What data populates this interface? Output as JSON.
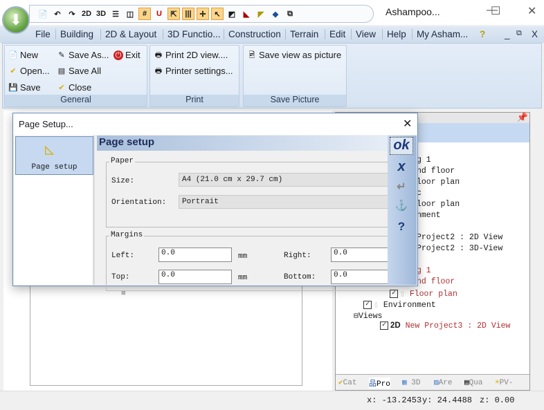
{
  "window": {
    "title": "Ashampoo...",
    "minimize": "—",
    "maximize": "☐",
    "close": "✕"
  },
  "qat": [
    "📄",
    "↶",
    "↷",
    "2D",
    "3D",
    "☰",
    "◫",
    "#",
    "U",
    "⇱",
    "|||",
    "✛",
    "↖",
    "◩",
    "◣",
    "◤",
    "◆",
    "⧉"
  ],
  "menu": {
    "tabs": [
      "File",
      "Building",
      "2D & Layout",
      "3D Functio...",
      "Construction",
      "Terrain",
      "Edit",
      "View",
      "Help",
      "My Asham..."
    ],
    "help_icon": "?",
    "win_min": "_",
    "win_restore": "⧉",
    "win_close": "X"
  },
  "ribbon": {
    "general": {
      "label": "General",
      "new": "New",
      "open": "Open...",
      "save": "Save",
      "save_as": "Save As...",
      "save_all": "Save All",
      "close": "Close",
      "exit": "Exit"
    },
    "print": {
      "label": "Print",
      "print_2d": "Print 2D view....",
      "printer_settings": "Printer settings..."
    },
    "save_picture": {
      "label": "Save Picture",
      "save_view": "Save view as picture"
    }
  },
  "dialog": {
    "title": "Page Setup...",
    "close": "✕",
    "nav_item": "Page setup",
    "header": "Page setup",
    "paper": {
      "legend": "Paper",
      "size_label": "Size:",
      "size_value": "A4   (21.0 cm x 29.7 cm)",
      "orientation_label": "Orientation:",
      "orientation_value": "Portrait"
    },
    "margins": {
      "legend": "Margins",
      "left_label": "Left:",
      "left_value": "0.0",
      "right_label": "Right:",
      "right_value": "0.0",
      "top_label": "Top:",
      "top_value": "0.0",
      "bottom_label": "Bottom:",
      "bottom_value": "0.0",
      "unit": "mm"
    },
    "buttons": {
      "ok": "ok",
      "cancel": "x",
      "apply": "↵",
      "anchor": "⚓",
      "help": "?"
    }
  },
  "tree": [
    {
      "text": "g 1",
      "red": false
    },
    {
      "text": "nd floor",
      "red": false
    },
    {
      "text": "loor plan",
      "red": false
    },
    {
      "text": "c",
      "red": false
    },
    {
      "text": "loor plan",
      "red": false
    },
    {
      "text": "nment",
      "red": false
    },
    {
      "text": "Project2 : 2D View",
      "red": false
    },
    {
      "text": "Project2 : 3D-View",
      "red": false
    },
    {
      "text": "g 1",
      "red": true
    },
    {
      "text": "nd floor",
      "red": true
    }
  ],
  "tree_lower": {
    "floor_plan": "Floor plan",
    "environment": "Environment",
    "views": "Views",
    "view_2d_badge": "2D",
    "view_2d": "New Project3 : 2D View"
  },
  "panel_tabs": [
    "Cat",
    "Pro",
    "3D",
    "Are",
    "Qua",
    "PV-"
  ],
  "status": {
    "x": "x: -13.2453",
    "y": "y: 24.4488",
    "z": "z: 0.00"
  }
}
